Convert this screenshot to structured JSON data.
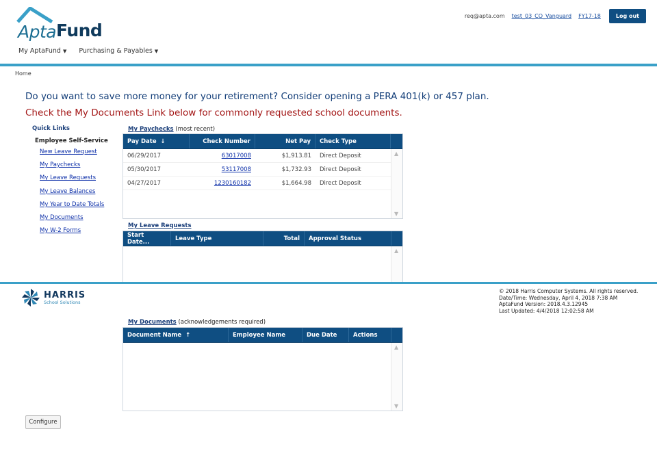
{
  "brand": {
    "apta": "Apta",
    "fund": "Fund"
  },
  "header": {
    "email": "req@apta.com",
    "org_link": "test_03_CO_Vanguard",
    "fy_link": "FY17-18",
    "logout_label": "Log out"
  },
  "menu": {
    "item1": "My AptaFund",
    "item2": "Purchasing & Payables"
  },
  "breadcrumb": "Home",
  "messages": {
    "retirement": "Do you want to save more money for your retirement?  Consider opening a PERA 401(k) or 457 plan.",
    "documents": "Check the My Documents Link below for commonly requested school documents."
  },
  "quick_links": {
    "title": "Quick Links",
    "section": "Employee Self-Service",
    "items": [
      "New Leave Request",
      "My Paychecks",
      "My Leave Requests",
      "My Leave Balances",
      "My Year to Date Totals",
      "My Documents",
      "My W-2 Forms"
    ]
  },
  "paychecks": {
    "title_link": "My Paychecks",
    "title_suffix": "(most recent)",
    "columns": [
      "Pay Date",
      "Check Number",
      "Net Pay",
      "Check Type"
    ],
    "sort_arrow": "↓",
    "rows": [
      {
        "date": "06/29/2017",
        "check": "63017008",
        "net": "$1,913.81",
        "type": "Direct Deposit"
      },
      {
        "date": "05/30/2017",
        "check": "53117008",
        "net": "$1,732.93",
        "type": "Direct Deposit"
      },
      {
        "date": "04/27/2017",
        "check": "1230160182",
        "net": "$1,664.98",
        "type": "Direct Deposit"
      }
    ]
  },
  "leave_requests": {
    "title_link": "My Leave Requests",
    "columns": [
      "Start Date...",
      "Leave Type",
      "Total",
      "Approval Status"
    ]
  },
  "documents": {
    "title_link": "My Documents",
    "title_suffix": "(acknowledgements required)",
    "columns": [
      "Document Name",
      "Employee Name",
      "Due Date",
      "Actions"
    ],
    "sort_arrow": "↑"
  },
  "footer": {
    "company": "HARRIS",
    "company_sub": "School Solutions",
    "copyright": "© 2018 Harris Computer Systems. All rights reserved.",
    "datetime": "Date/Time: Wednesday, April 4, 2018 7:38 AM",
    "version": "AptaFund Version: 2018.4.3.12945",
    "updated": "Last Updated: 4/4/2018 12:02:58 AM"
  },
  "configure_label": "Configure",
  "colors": {
    "accent": "#3aa0c8",
    "grid_header": "#0f4e82",
    "alert": "#a31616"
  }
}
